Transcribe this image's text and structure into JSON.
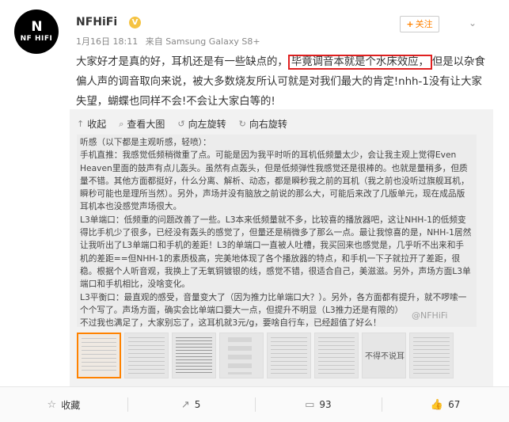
{
  "user": {
    "name": "NFHiFi",
    "avatar_logo_mark": "N",
    "avatar_logo_text": "NF HIFI",
    "badge": "V",
    "date": "1月16日 18:11",
    "source": "来自 Samsung Galaxy S8+",
    "follow_label": "关注",
    "more": "⌄"
  },
  "post": {
    "before": "大家好才是真的好，耳机还是有一些缺点的，",
    "highlighted": "毕竟调音本就是个水床效应，",
    "after": "但是以杂食偏人声的调音取向来说，被大多数烧友所认可就是对我们最大的肯定!nhh-1没有让大家失望，蝴蝶也同样不会!不会让大家白等的!"
  },
  "actions": [
    {
      "icon": "↑",
      "label": "收起"
    },
    {
      "icon": "⌕",
      "label": "查看大图"
    },
    {
      "icon": "↺",
      "label": "向左旋转"
    },
    {
      "icon": "↻",
      "label": "向右旋转"
    }
  ],
  "image": {
    "text": "听感（以下都是主观听感，轻喷）：\n手机直推：我感觉低频稍微重了点。可能是因为我平时听的耳机低频量太少，会让我主观上觉得Even Heaven里面的鼓声有点儿轰头。虽然有点轰头，但是低频弹性我感觉还是很棒的。也就是量稍多，但质量不错。其他方面都挺好，什么分离、解析、动态，都是瞬秒我之前的耳机（我之前也没听过旗舰耳机，瞬秒可能也是理所当然）。另外，声场并没有脑放之前说的那么大，可能后来改了几版单元，现在成品版耳机本也没感觉声场很大。\nL3单端口：低频重的问题改善了一些。L3本来低频量就不多，比较喜的播放器吧，这让NHH-1的低频变得比手机少了很多，已经没有轰头的感觉了，但量还是稍微多了那么一点。最让我惊喜的是，NHH-1居然让我听出了L3单端口和手机的差距！L3的单端口一直被人吐槽，我买回来也感觉是，几乎听不出来和手机的差距==但NHH-1的素质极高，完美地体现了各个播放器的特点，和手机一下子就拉开了差距，很稳。根据个人听音观，我换上了无氧铜镀银的线，感觉不错，很适合自己，美滋滋。另外，声场方面L3单端口和手机相比，没啥变化。\nL3平衡口：最直观的感受，音量变大了（因为推力比单端口大？）。另外，各方面都有提升，就不啰嗦一个个写了。声场方面，确实会比单端口要大一点，但提升不明显（L3推力还是有限的）\n不过我也满足了，大家别忘了，这耳机就3元/g，要啥自行车，已经超值了好么！",
    "watermark": "@NFHiFi",
    "thumb_caption": "不得不说耳"
  },
  "bottom": [
    {
      "icon": "☆",
      "label": "收藏"
    },
    {
      "icon": "↗",
      "label": "5"
    },
    {
      "icon": "▭",
      "label": "93"
    },
    {
      "icon": "👍",
      "label": "67"
    }
  ]
}
